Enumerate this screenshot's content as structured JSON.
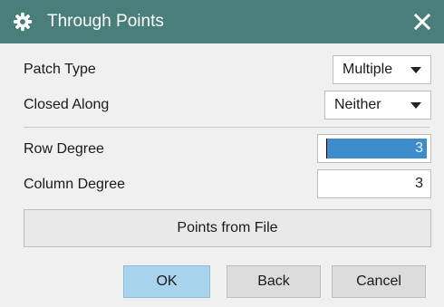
{
  "dialog": {
    "title": "Through Points",
    "title_icon": "gear-icon",
    "close_icon": "close-icon"
  },
  "patch_type": {
    "label": "Patch Type",
    "value": "Multiple"
  },
  "closed_along": {
    "label": "Closed Along",
    "value": "Neither"
  },
  "row_degree": {
    "label": "Row Degree",
    "value": "3"
  },
  "column_degree": {
    "label": "Column Degree",
    "value": "3"
  },
  "points_from_file": {
    "label": "Points from File"
  },
  "buttons": {
    "ok": "OK",
    "back": "Back",
    "cancel": "Cancel"
  },
  "colors": {
    "titlebar": "#497e7a",
    "selection": "#3f8ccc",
    "primary_button": "#a9d4ee"
  }
}
